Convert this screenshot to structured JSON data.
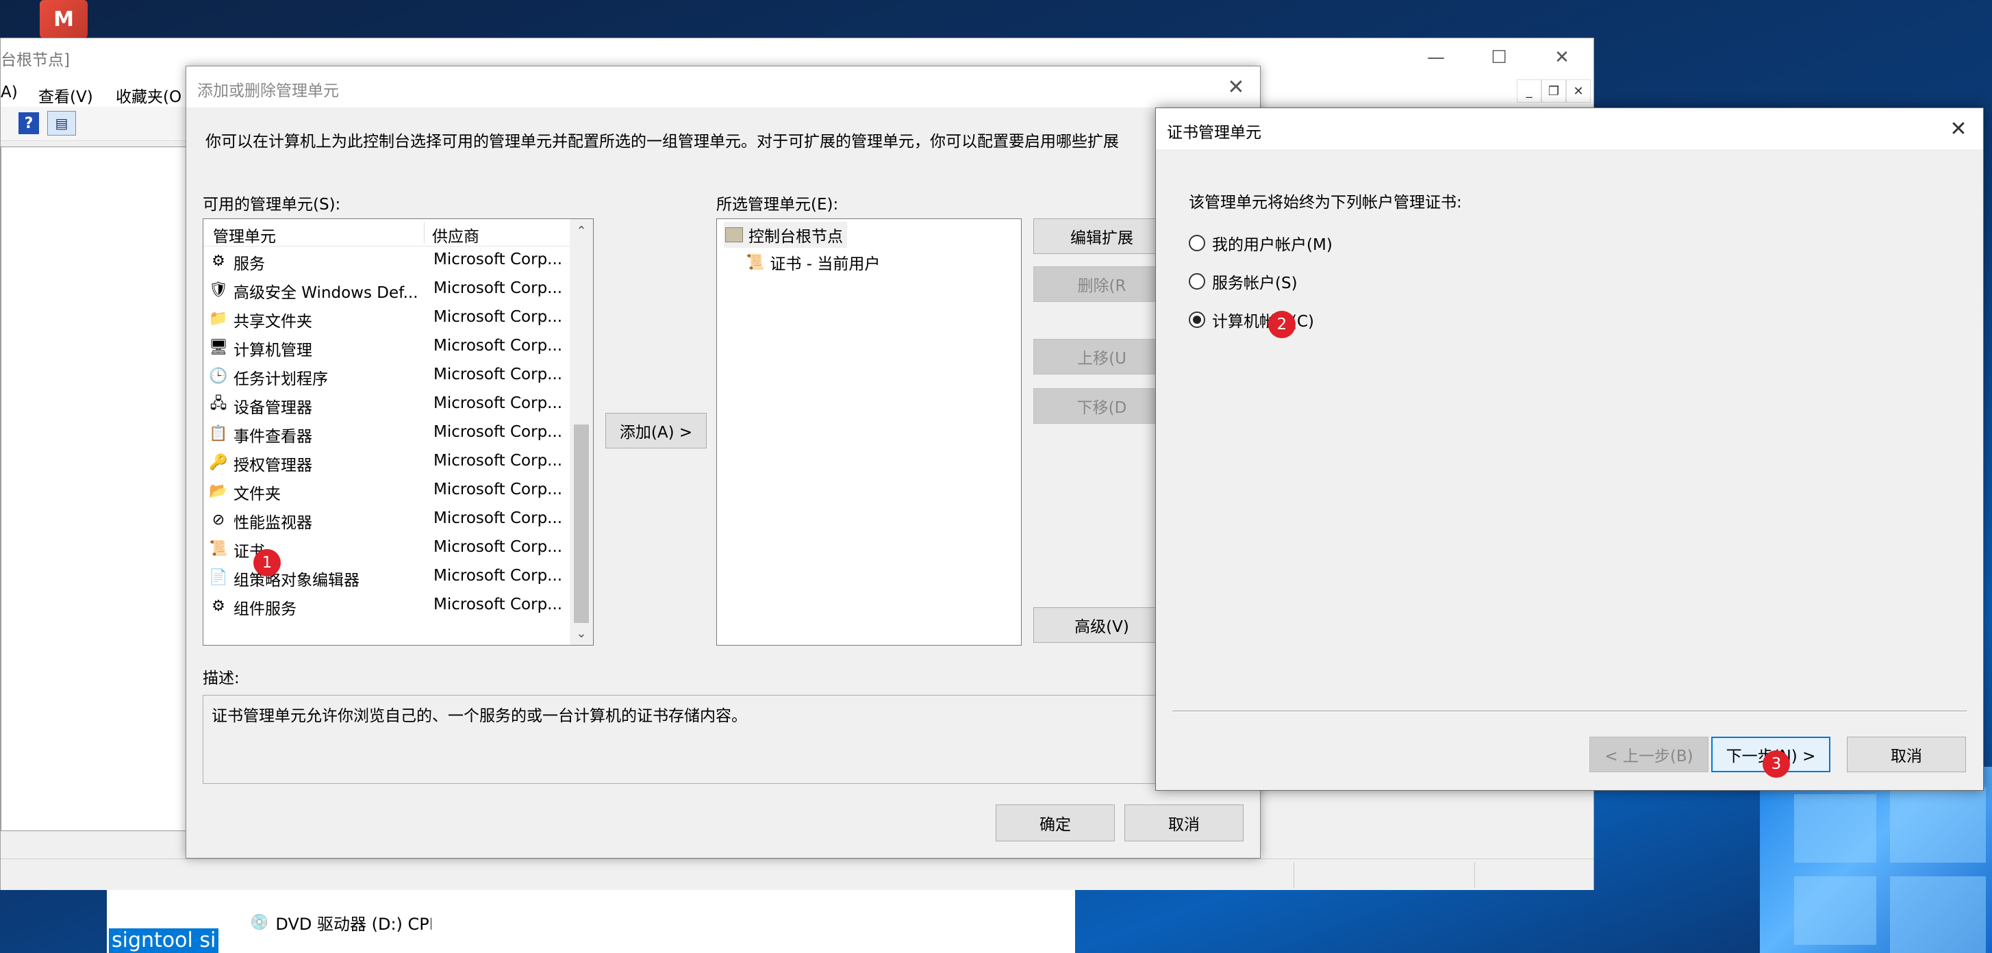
{
  "colors": {
    "accent": "#0078d7",
    "step_marker": "#e0202a"
  },
  "desktop": {
    "app_icon_letter": "M",
    "explorer": {
      "selected_text": "signtool si",
      "drive_label": "DVD 驱动器 (D:) CPE"
    }
  },
  "console": {
    "title": "台根节点]",
    "menu": [
      "A)",
      "查看(V)",
      "收藏夹(O"
    ],
    "caption_buttons": {
      "minimize": "—",
      "maximize": "☐",
      "close": "✕"
    },
    "mini_caption_buttons": {
      "minimize": "_",
      "restore": "❐",
      "close": "✕"
    },
    "toolbar_icons": [
      "help-icon",
      "console-view-icon"
    ]
  },
  "addremove": {
    "title": "添加或删除管理单元",
    "close": "✕",
    "intro": "你可以在计算机上为此控制台选择可用的管理单元并配置所选的一组管理单元。对于可扩展的管理单元，你可以配置要启用哪些扩展",
    "available_label": "可用的管理单元(S):",
    "columns": {
      "name": "管理单元",
      "vendor": "供应商"
    },
    "snapins": [
      {
        "name": "服务",
        "vendor": "Microsoft Corp...",
        "icon": "⚙"
      },
      {
        "name": "高级安全 Windows Def...",
        "vendor": "Microsoft Corp...",
        "icon": "🛡"
      },
      {
        "name": "共享文件夹",
        "vendor": "Microsoft Corp...",
        "icon": "📁"
      },
      {
        "name": "计算机管理",
        "vendor": "Microsoft Corp...",
        "icon": "🖥"
      },
      {
        "name": "任务计划程序",
        "vendor": "Microsoft Corp...",
        "icon": "🕒"
      },
      {
        "name": "设备管理器",
        "vendor": "Microsoft Corp...",
        "icon": "🖧"
      },
      {
        "name": "事件查看器",
        "vendor": "Microsoft Corp...",
        "icon": "📋"
      },
      {
        "name": "授权管理器",
        "vendor": "Microsoft Corp...",
        "icon": "🔑"
      },
      {
        "name": "文件夹",
        "vendor": "Microsoft Corp...",
        "icon": "📂"
      },
      {
        "name": "性能监视器",
        "vendor": "Microsoft Corp...",
        "icon": "⊘"
      },
      {
        "name": "证书",
        "vendor": "Microsoft Corp...",
        "icon": "📜"
      },
      {
        "name": "组策略对象编辑器",
        "vendor": "Microsoft Corp...",
        "icon": "📄"
      },
      {
        "name": "组件服务",
        "vendor": "Microsoft Corp...",
        "icon": "⚙"
      }
    ],
    "scroll_up": "⌃",
    "scroll_down": "⌄",
    "add_button": "添加(A) >",
    "selected_label": "所选管理单元(E):",
    "selected_tree": {
      "root": "控制台根节点",
      "child": "证书 - 当前用户"
    },
    "side_buttons": {
      "edit_extensions": "编辑扩展",
      "remove": "删除(R",
      "move_up": "上移(U",
      "move_down": "下移(D",
      "advanced": "高级(V)"
    },
    "description_label": "描述:",
    "description": "证书管理单元允许你浏览自己的、一个服务的或一台计算机的证书存储内容。",
    "ok": "确定",
    "cancel": "取消"
  },
  "cert_dialog": {
    "title": "证书管理单元",
    "close": "✕",
    "prompt": "该管理单元将始终为下列帐户管理证书:",
    "options": [
      {
        "label": "我的用户帐户(M)",
        "selected": false
      },
      {
        "label": "服务帐户(S)",
        "selected": false
      },
      {
        "label": "计算机帐户(C)",
        "selected": true
      }
    ],
    "back": "< 上一步(B)",
    "next": "下一步(N) >",
    "cancel": "取消"
  },
  "step_markers": [
    "1",
    "2",
    "3"
  ]
}
